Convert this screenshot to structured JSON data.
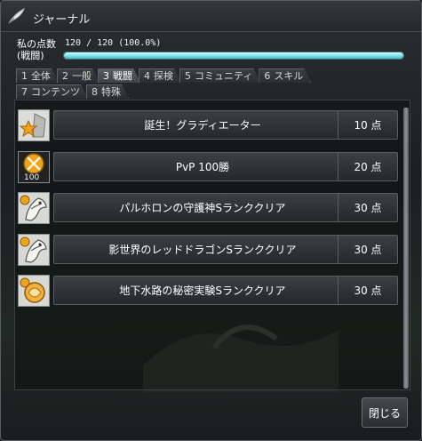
{
  "window": {
    "title": "ジャーナル"
  },
  "score": {
    "label_line1": "私の点数",
    "label_line2": "(戦闘)",
    "value": "120 / 120 (100.0%)",
    "progress": 1.0
  },
  "tabs_row1": [
    {
      "num": "1",
      "label": "全体",
      "active": false
    },
    {
      "num": "2",
      "label": "一般",
      "active": false
    },
    {
      "num": "3",
      "label": "戦闘",
      "active": true
    },
    {
      "num": "4",
      "label": "探検",
      "active": false
    },
    {
      "num": "5",
      "label": "コミュニティ",
      "active": false
    },
    {
      "num": "6",
      "label": "スキル",
      "active": false
    }
  ],
  "tabs_row2": [
    {
      "num": "7",
      "label": "コンテンツ",
      "active": false
    },
    {
      "num": "8",
      "label": "特殊",
      "active": false
    }
  ],
  "achievements": [
    {
      "name": "誕生！グラディエーター",
      "points": "10 点",
      "icon": "gladiator-star-icon",
      "badge": ""
    },
    {
      "name": "PvP 100勝",
      "points": "20 点",
      "icon": "crossed-swords-icon",
      "badge": "100"
    },
    {
      "name": "パルホロンの守護神Sランククリア",
      "points": "30 点",
      "icon": "dragon-head-icon",
      "badge": ""
    },
    {
      "name": "影世界のレッドドラゴンSランククリア",
      "points": "30 点",
      "icon": "dragon-head-icon",
      "badge": ""
    },
    {
      "name": "地下水路の秘密実験Sランククリア",
      "points": "30 点",
      "icon": "orb-icon",
      "badge": ""
    }
  ],
  "buttons": {
    "close": "閉じる"
  },
  "colors": {
    "progress": "#6ee0ea",
    "accent_star": "#f0a31a"
  }
}
